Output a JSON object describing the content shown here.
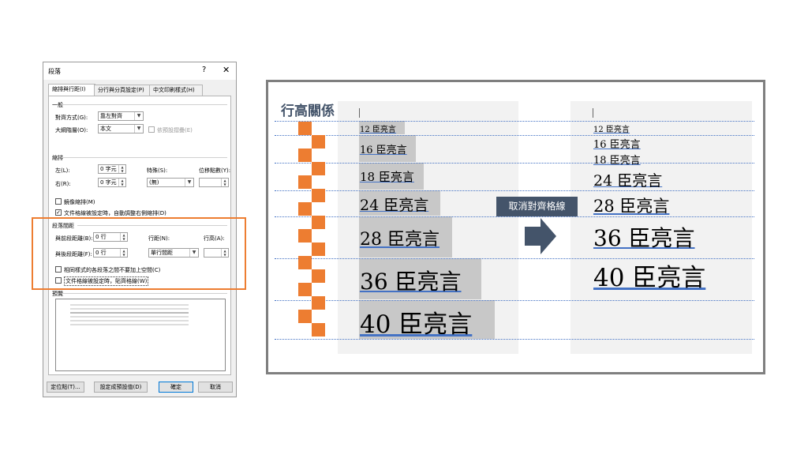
{
  "dialog": {
    "title": "段落",
    "help": "?",
    "close": "✕",
    "tabs": [
      "縮排與行距(I)",
      "分行與分頁設定(P)",
      "中文印刷樣式(H)"
    ],
    "general": {
      "section": "一般",
      "alignment_label": "對齊方式(G):",
      "alignment_value": "靠左對齊",
      "outline_label": "大綱階層(O):",
      "outline_value": "本文",
      "collapsed_label": "依預設摺疊(E)"
    },
    "indent": {
      "section": "縮排",
      "left_label": "左(L):",
      "left_value": "0 字元",
      "right_label": "右(R):",
      "right_value": "0 字元",
      "special_label": "特殊(S):",
      "special_value": "(無)",
      "offset_label": "位移點數(Y):",
      "mirror_label": "鏡像縮排(M)",
      "auto_adjust_label": "文件格線被設定時，自動調整右側縮排(D)"
    },
    "spacing": {
      "section": "段落間距",
      "before_label": "與前段距離(B):",
      "before_value": "0 行",
      "after_label": "與後段距離(F):",
      "after_value": "0 行",
      "line_spacing_label": "行距(N):",
      "line_spacing_value": "單行間距",
      "at_label": "行高(A):",
      "no_space_label": "相同樣式的各段落之間不要加上空間(C)",
      "snap_grid_label": "文件格線被設定時，貼齊格線(W)"
    },
    "preview_label": "預覽",
    "buttons": {
      "tabs": "定位點(T)...",
      "default": "設定成預設值(D)",
      "ok": "確定",
      "cancel": "取消"
    }
  },
  "illustration": {
    "title": "行高關係",
    "samples": [
      "12 臣亮言",
      "16 臣亮言",
      "18 臣亮言",
      "24 臣亮言",
      "28 臣亮言",
      "36 臣亮言",
      "40 臣亮言"
    ],
    "cancel_grid_label": "取消對齊格線",
    "colors": {
      "accent_orange": "#ed7d31",
      "grid_blue": "#4472c4",
      "label_bg": "#44546a",
      "frame": "#7f7f7f"
    }
  }
}
